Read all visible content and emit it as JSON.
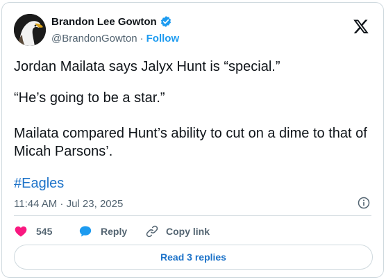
{
  "tweet": {
    "author": {
      "display_name": "Brandon Lee Gowton",
      "handle": "@BrandonGowton",
      "separator": "·",
      "follow_label": "Follow",
      "verified": true,
      "avatar_icon": "eagle-avatar"
    },
    "text": {
      "p1": "Jordan Mailata says Jalyx Hunt is “special.”",
      "p2": "“He’s going to be a star.”",
      "p3": "Mailata compared Hunt’s ability to cut on a dime to that of Micah Parsons’.",
      "hashtag": "#Eagles"
    },
    "timestamp": "11:44 AM · Jul 23, 2025",
    "actions": {
      "like_count": "545",
      "reply_label": "Reply",
      "copy_label": "Copy link"
    },
    "read_replies_label": "Read 3 replies"
  },
  "colors": {
    "like": "#f91880",
    "reply": "#1d9bf0",
    "link": "#1d73c9",
    "verified": "#1d9bf0",
    "muted": "#536471",
    "border": "#cfd9de"
  }
}
